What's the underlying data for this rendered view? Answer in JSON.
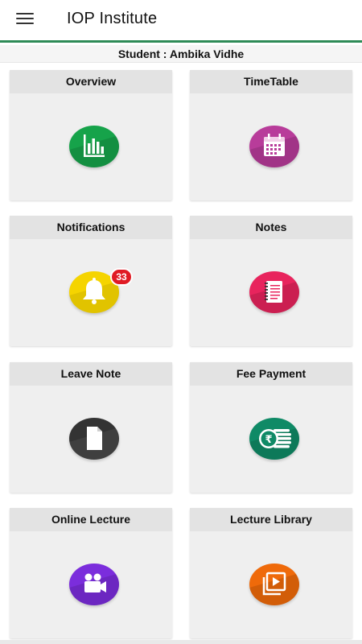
{
  "app": {
    "title": "IOP Institute"
  },
  "student": {
    "label": "Student : Ambika Vidhe"
  },
  "colors": {
    "accent_line": "#2e8b57"
  },
  "tiles": [
    {
      "label": "Overview",
      "icon": "bar-chart-icon",
      "color": "#16a34a"
    },
    {
      "label": "TimeTable",
      "icon": "calendar-icon",
      "color": "#b83c9a"
    },
    {
      "label": "Notifications",
      "icon": "bell-icon",
      "color": "#f5d400",
      "badge": "33"
    },
    {
      "label": "Notes",
      "icon": "notepad-icon",
      "color": "#e8245d"
    },
    {
      "label": "Leave Note",
      "icon": "document-icon",
      "color": "#333333"
    },
    {
      "label": "Fee Payment",
      "icon": "rupee-coins-icon",
      "color": "#0f8a66"
    },
    {
      "label": "Online Lecture",
      "icon": "video-camera-icon",
      "color": "#7b2ddc"
    },
    {
      "label": "Lecture Library",
      "icon": "video-library-icon",
      "color": "#ef6a0a"
    }
  ]
}
